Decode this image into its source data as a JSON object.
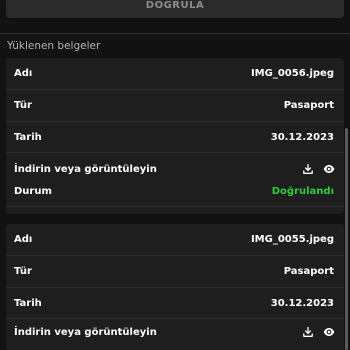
{
  "verify_button": {
    "label": "DOĞRULA"
  },
  "section": {
    "title": "Yüklenen belgeler"
  },
  "documents": [
    {
      "name_label": "Adı",
      "name_value": "IMG_0056.jpeg",
      "type_label": "Tür",
      "type_value": "Pasaport",
      "date_label": "Tarih",
      "date_value": "30.12.2023",
      "action_label": "İndirin veya görüntüleyin",
      "status_label": "Durum",
      "status_value": "Doğrulandı"
    },
    {
      "name_label": "Adı",
      "name_value": "IMG_0055.jpeg",
      "type_label": "Tür",
      "type_value": "Pasaport",
      "date_label": "Tarih",
      "date_value": "30.12.2023",
      "action_label": "İndirin veya görüntüleyin"
    }
  ],
  "icons": {
    "download": "download-icon",
    "view": "eye-icon"
  },
  "colors": {
    "background": "#121212",
    "card": "#1e1e1e",
    "verified": "#2ecc40"
  }
}
